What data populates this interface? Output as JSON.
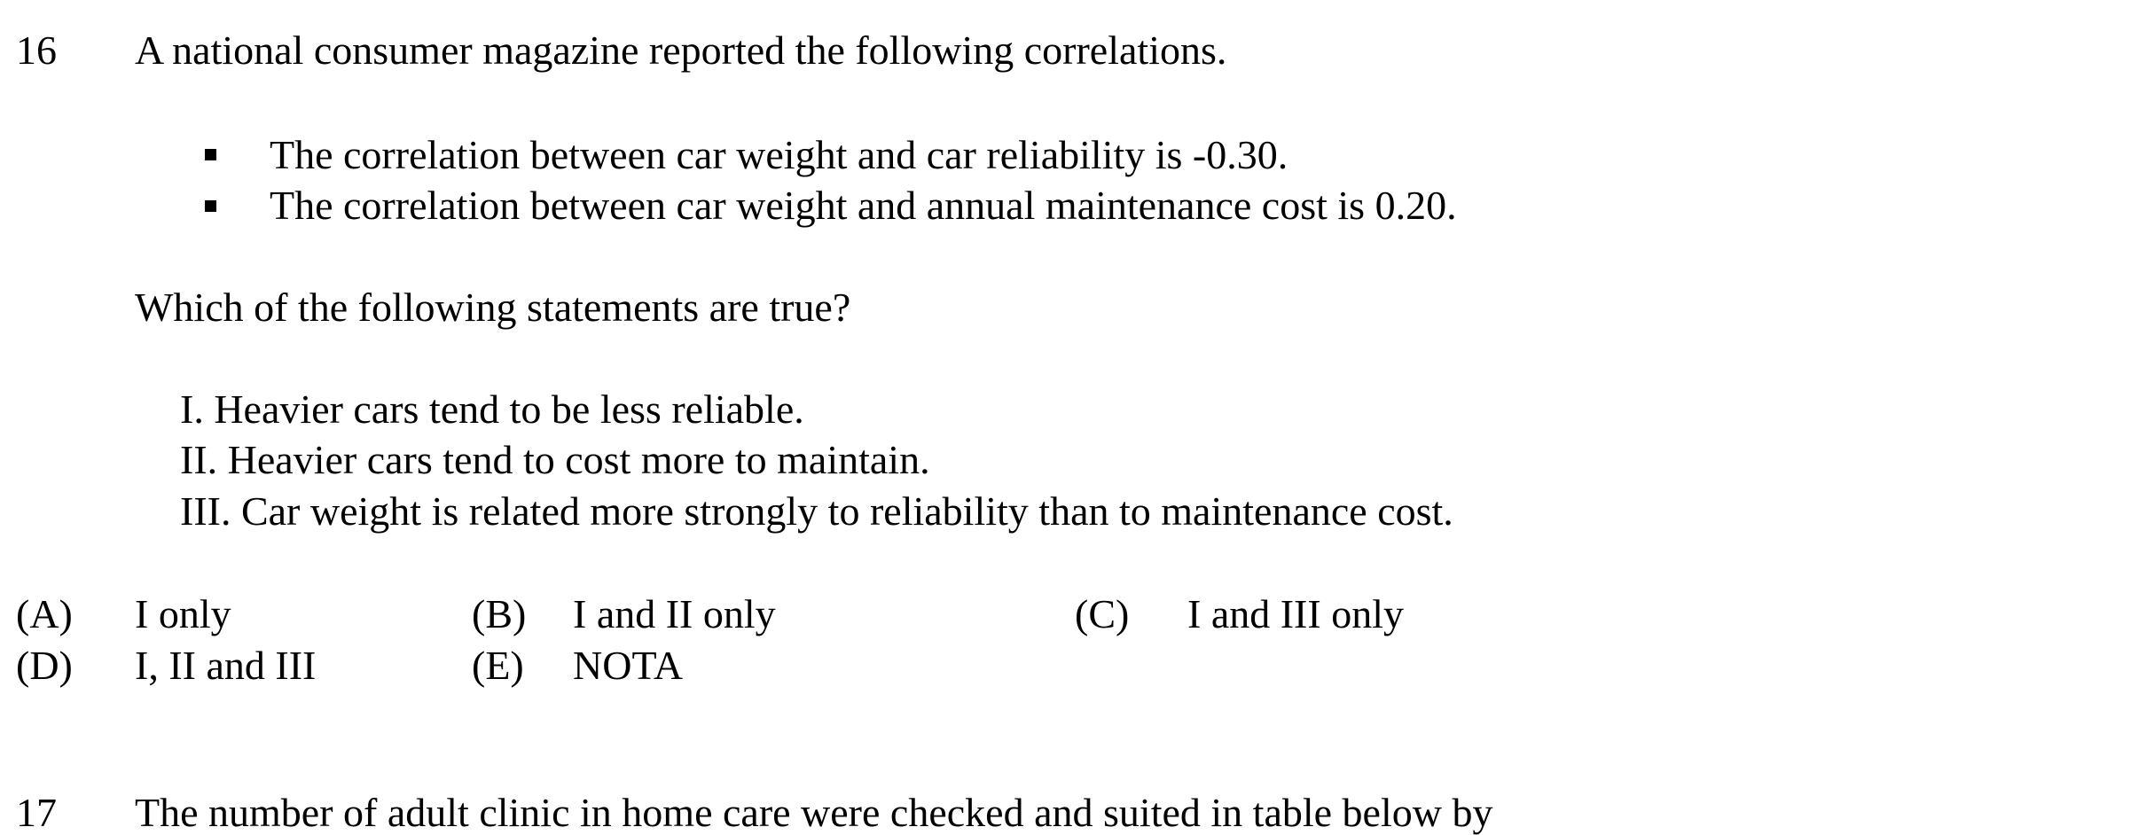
{
  "question16": {
    "number": "16",
    "stem": "A national consumer magazine reported the following correlations.",
    "bullets": [
      "The correlation between car weight and car reliability is -0.30.",
      "The correlation between car weight and annual maintenance cost is 0.20."
    ],
    "prompt": "Which of the following statements are true?",
    "statements": [
      "I. Heavier cars tend to be less reliable.",
      "II. Heavier cars tend to cost more to maintain.",
      "III. Car weight is related more strongly to reliability than to maintenance cost."
    ],
    "choices": [
      {
        "letter": "(A)",
        "text": "I only"
      },
      {
        "letter": "(B)",
        "text": "I and II only"
      },
      {
        "letter": "(C)",
        "text": "I and III only"
      },
      {
        "letter": "(D)",
        "text": "I, II and III"
      },
      {
        "letter": "(E)",
        "text": "NOTA"
      }
    ]
  },
  "question17": {
    "number": "17",
    "stem": "The number of adult clinic in home care were checked and suited in table below by"
  }
}
